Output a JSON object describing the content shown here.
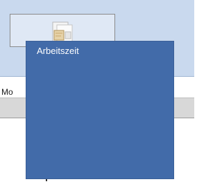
{
  "ribbon": {
    "icon": "document-notes-icon"
  },
  "tabs": {
    "visible_label": "Mo"
  },
  "popup": {
    "title": "Arbeitszeit"
  },
  "colors": {
    "ribbon_background": "#c9d9ee",
    "popup_background": "#426ba9",
    "grey_band": "#d8d8d8"
  }
}
